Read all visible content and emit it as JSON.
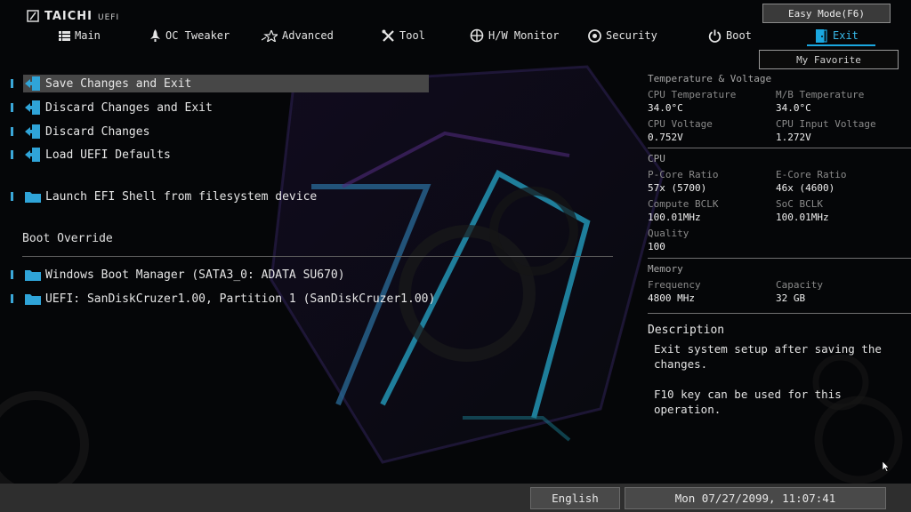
{
  "brand": {
    "name": "TAICHI",
    "sub": "UEFI"
  },
  "top_buttons": {
    "easy_mode": "Easy Mode(F6)",
    "my_favorite": "My Favorite"
  },
  "tabs": [
    {
      "label": "Main",
      "icon": "list-icon"
    },
    {
      "label": "OC Tweaker",
      "icon": "rocket-icon"
    },
    {
      "label": "Advanced",
      "icon": "star-icon"
    },
    {
      "label": "Tool",
      "icon": "tools-icon"
    },
    {
      "label": "H/W Monitor",
      "icon": "monitor-icon"
    },
    {
      "label": "Security",
      "icon": "shield-icon"
    },
    {
      "label": "Boot",
      "icon": "power-icon"
    },
    {
      "label": "Exit",
      "icon": "exit-icon",
      "active": true
    }
  ],
  "menu": {
    "save_exit": "Save Changes and Exit",
    "discard_exit": "Discard Changes and Exit",
    "discard": "Discard Changes",
    "load_defaults": "Load UEFI Defaults",
    "efi_shell": "Launch EFI Shell from filesystem device",
    "boot_override_title": "Boot Override",
    "boot_windows": "Windows Boot Manager (SATA3_0: ADATA SU670)",
    "boot_usb": "UEFI: SanDiskCruzer1.00, Partition 1 (SanDiskCruzer1.00)"
  },
  "monitor": {
    "temp_title": "Temperature & Voltage",
    "cpu_temp_label": "CPU Temperature",
    "cpu_temp": "34.0°C",
    "mb_temp_label": "M/B Temperature",
    "mb_temp": "34.0°C",
    "cpu_volt_label": "CPU Voltage",
    "cpu_volt": "0.752V",
    "cpu_in_volt_label": "CPU Input Voltage",
    "cpu_in_volt": "1.272V",
    "cpu_title": "CPU",
    "pcore_label": "P-Core Ratio",
    "pcore": "57x (5700)",
    "ecore_label": "E-Core Ratio",
    "ecore": "46x (4600)",
    "bclk_label": "Compute BCLK",
    "bclk": "100.01MHz",
    "soc_label": "SoC BCLK",
    "soc": "100.01MHz",
    "quality_label": "Quality",
    "quality": "100",
    "mem_title": "Memory",
    "freq_label": "Frequency",
    "freq": "4800 MHz",
    "cap_label": "Capacity",
    "cap": "32 GB"
  },
  "description": {
    "title": "Description",
    "text": "Exit system setup after saving the\nchanges.\n\nF10 key can be used for this operation."
  },
  "footer": {
    "language": "English",
    "datetime": "Mon 07/27/2099, 11:07:41"
  },
  "colors": {
    "accent": "#37b8e8",
    "marker": "#3aa7d8",
    "selection": "#474747"
  }
}
